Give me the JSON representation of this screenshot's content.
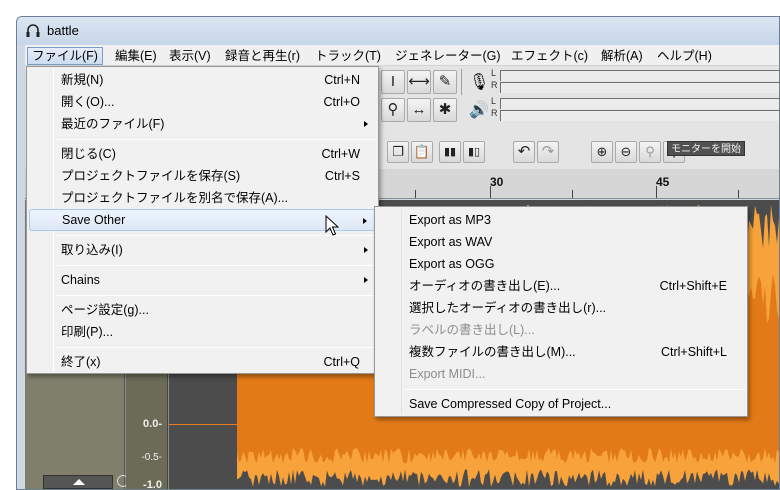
{
  "window": {
    "title": "battle"
  },
  "menubar": [
    {
      "label": "ファイル(F)",
      "open": true
    },
    {
      "label": "編集(E)"
    },
    {
      "label": "表示(V)"
    },
    {
      "label": "録音と再生(r)"
    },
    {
      "label": "トラック(T)"
    },
    {
      "label": "ジェネレーター(G)"
    },
    {
      "label": "エフェクト(c)"
    },
    {
      "label": "解析(A)"
    },
    {
      "label": "ヘルプ(H)"
    }
  ],
  "toolbar": {
    "monitor_button": "モニターを開始",
    "meter_left": "L",
    "meter_right": "R"
  },
  "ruler": {
    "labels": [
      "30",
      "45"
    ]
  },
  "track": {
    "scale": [
      {
        "label": "0.0-"
      },
      {
        "label": "-0.5-"
      },
      {
        "label": "-1.0"
      }
    ]
  },
  "file_menu": {
    "items": [
      {
        "label": "新規(N)",
        "shortcut": "Ctrl+N"
      },
      {
        "label": "開く(O)...",
        "shortcut": "Ctrl+O"
      },
      {
        "label": "最近のファイル(F)",
        "submenu": true
      },
      {
        "label": "閉じる(C)",
        "shortcut": "Ctrl+W"
      },
      {
        "label": "プロジェクトファイルを保存(S)",
        "shortcut": "Ctrl+S"
      },
      {
        "label": "プロジェクトファイルを別名で保存(A)..."
      },
      {
        "label": "Save Other",
        "submenu": true,
        "highlighted": true
      },
      {
        "label": "取り込み(I)",
        "submenu": true
      },
      {
        "label": "Chains",
        "submenu": true
      },
      {
        "label": "ページ設定(g)..."
      },
      {
        "label": "印刷(P)..."
      },
      {
        "label": "終了(x)",
        "shortcut": "Ctrl+Q"
      }
    ]
  },
  "save_other_menu": {
    "items": [
      {
        "label": "Export as MP3"
      },
      {
        "label": "Export as WAV"
      },
      {
        "label": "Export as OGG"
      },
      {
        "label": "オーディオの書き出し(E)...",
        "shortcut": "Ctrl+Shift+E"
      },
      {
        "label": "選択したオーディオの書き出し(r)..."
      },
      {
        "label": "ラベルの書き出し(L)...",
        "disabled": true
      },
      {
        "label": "複数ファイルの書き出し(M)...",
        "shortcut": "Ctrl+Shift+L"
      },
      {
        "label": "Export MIDI...",
        "disabled": true
      },
      {
        "label": "Save Compressed Copy of Project..."
      }
    ]
  },
  "colors": {
    "waveform_orange": "#f7a23a",
    "waveform_dark": "#e37a18",
    "menu_highlight": "#dde9f8"
  }
}
